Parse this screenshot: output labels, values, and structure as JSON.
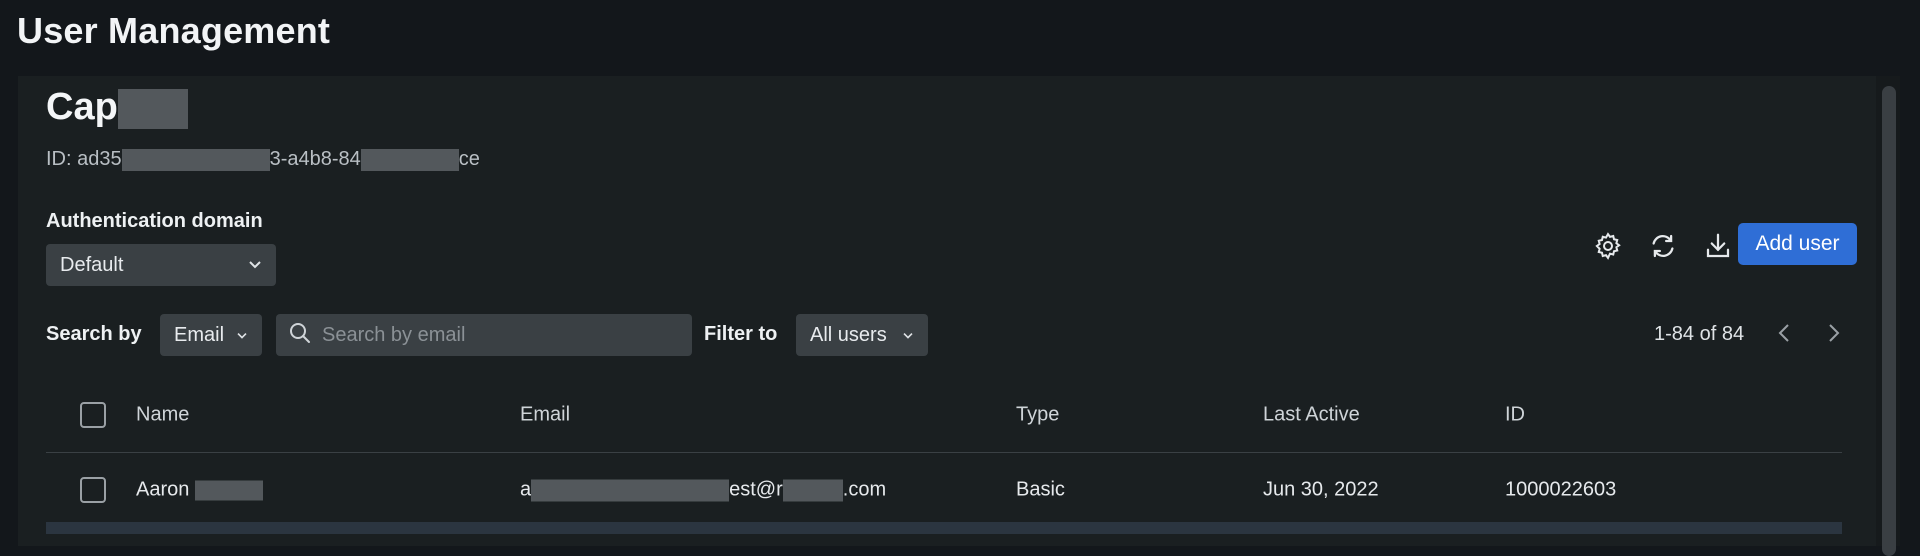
{
  "page": {
    "title": "User Management"
  },
  "org": {
    "name_visible": "Cap",
    "id_part1": "ID: ad35",
    "id_part2": "3-a4b8-84",
    "id_part3": "ce"
  },
  "auth": {
    "label": "Authentication domain",
    "selected": "Default"
  },
  "toolbar": {
    "settings_icon": "gear-icon",
    "refresh_icon": "refresh-icon",
    "download_icon": "download-icon",
    "add_user_label": "Add user",
    "accent": "#2f6ed6"
  },
  "search": {
    "label": "Search by",
    "field_selected": "Email",
    "placeholder": "Search by email"
  },
  "filter": {
    "label": "Filter to",
    "selected": "All users"
  },
  "pagination": {
    "range_text": "1-84 of 84"
  },
  "table": {
    "columns": [
      "Name",
      "Email",
      "Type",
      "Last Active",
      "ID"
    ],
    "rows": [
      {
        "name_visible": "Aaron",
        "email_prefix": "a",
        "email_mid": "est@r",
        "email_suffix": ".com",
        "type": "Basic",
        "last_active": "Jun 30, 2022",
        "id": "1000022603"
      }
    ]
  }
}
